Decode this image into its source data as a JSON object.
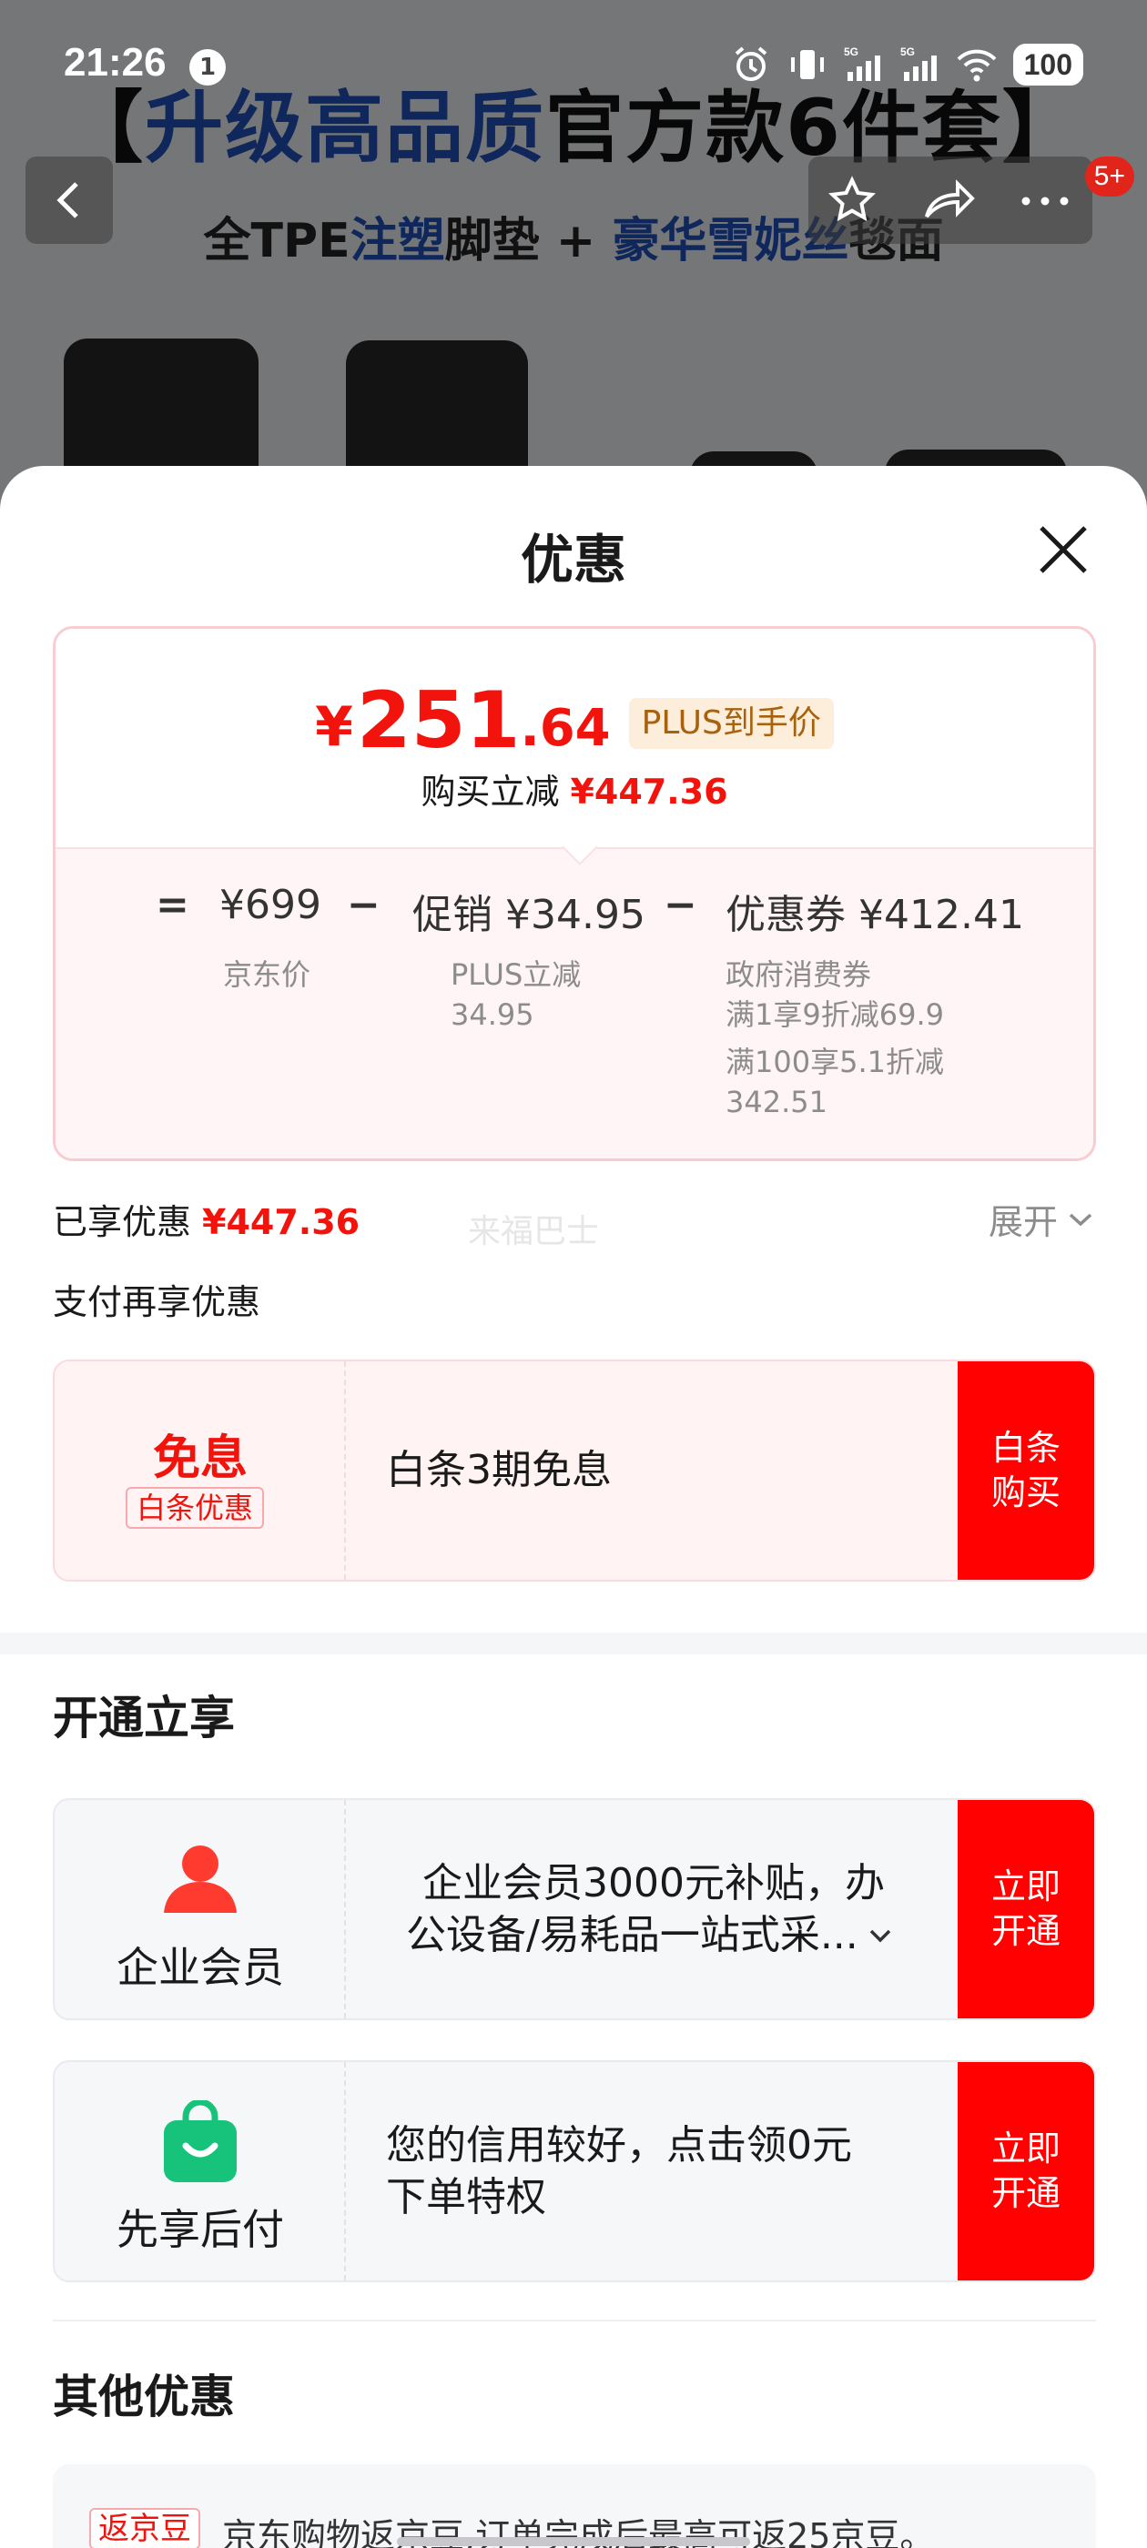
{
  "status_bar": {
    "time": "21:26",
    "notification_count": "1",
    "battery": "100",
    "network_1": "5G",
    "network_2": "5G"
  },
  "product_bg": {
    "headline_bracket_open": "【",
    "headline_blue": "升级高品质",
    "headline_black": "官方款6件套",
    "headline_bracket_close": "】",
    "sub_prefix": "全TPE",
    "sub_blue_1": "注塑",
    "sub_mid": "脚垫 + ",
    "sub_blue_2": "豪华雪妮丝",
    "sub_suffix": "毯面",
    "more_badge": "5+"
  },
  "sheet": {
    "title": "优惠"
  },
  "price_card": {
    "final_yen": "¥",
    "final_int": "251",
    "final_dec": ".64",
    "plus_tag": "PLUS到手价",
    "reduce_label": "购买立减",
    "reduce_value": "¥447.36",
    "equals": "=",
    "jd_price": "¥699",
    "jd_price_label": "京东价",
    "minus_1": "−",
    "promo": "促销 ¥34.95",
    "promo_detail_1": "PLUS立减",
    "promo_detail_2": "34.95",
    "minus_2": "−",
    "coupon": "优惠券 ¥412.41",
    "coupon_detail_1": "政府消费券",
    "coupon_detail_2": "满1享9折减69.9",
    "coupon_detail_3": "满100享5.1折减",
    "coupon_detail_4": "342.51"
  },
  "enjoyed": {
    "label": "已享优惠",
    "value": "¥447.36",
    "watermark": "来福巴士",
    "expand": "展开"
  },
  "pay_section": {
    "title": "支付再享优惠",
    "free_label": "免息",
    "tag": "白条优惠",
    "description": "白条3期免息",
    "action_1": "白条",
    "action_2": "购买"
  },
  "open_section": {
    "title": "开通立享",
    "items": [
      {
        "label": "企业会员",
        "line1": "企业会员3000元补贴，办",
        "line2": "公设备/易耗品一站式采...",
        "action_1": "立即",
        "action_2": "开通"
      },
      {
        "label": "先享后付",
        "line1": "您的信用较好，点击领0元",
        "line2": "下单特权",
        "action_1": "立即",
        "action_2": "开通"
      }
    ]
  },
  "other_section": {
    "title": "其他优惠",
    "tag": "返京豆",
    "text": "京东购物返京豆,订单完成后最高可返25京豆。"
  },
  "colors": {
    "accent_red": "#f2140c",
    "action_red": "#ff0100",
    "plus_gold": "#a8620d",
    "green": "#17c27a"
  }
}
